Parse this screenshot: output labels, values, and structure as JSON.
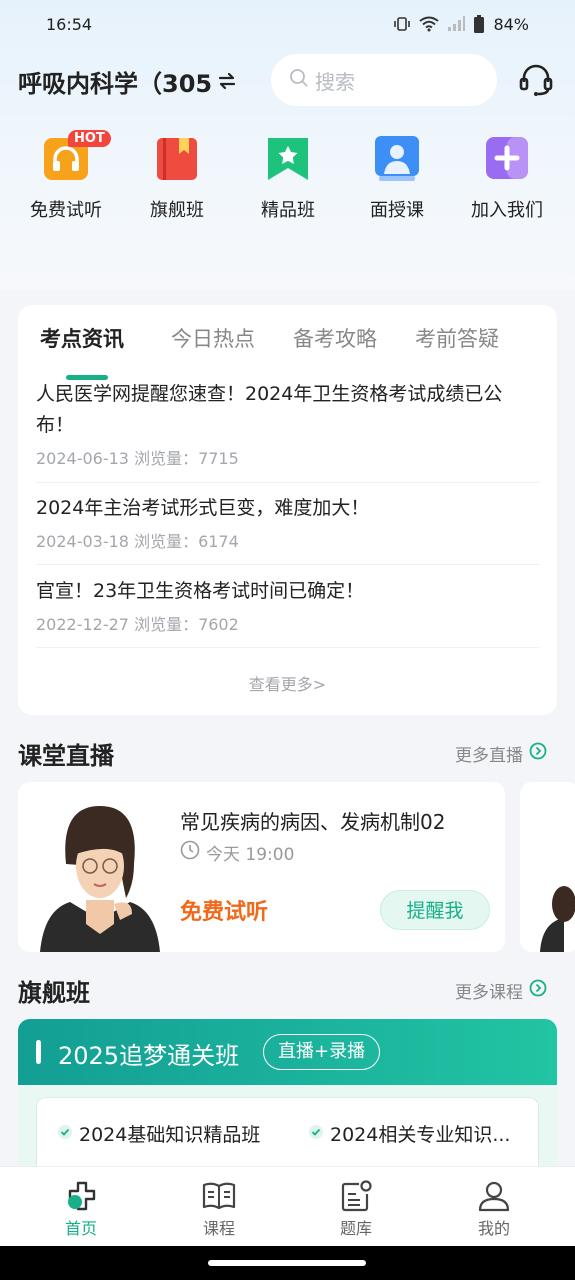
{
  "status_bar": {
    "time": "16:54",
    "battery": "84%"
  },
  "header": {
    "subject": "呼吸内科学（305",
    "search_placeholder": "搜索"
  },
  "quick_nav": [
    {
      "label": "免费试听",
      "badge": "HOT",
      "icon": "headphones-icon",
      "color": "#f7a21b"
    },
    {
      "label": "旗舰班",
      "icon": "book-bookmark-icon",
      "color": "#ef4b3e"
    },
    {
      "label": "精品班",
      "icon": "star-bookmark-icon",
      "color": "#1fc27c"
    },
    {
      "label": "面授课",
      "icon": "teacher-icon",
      "color": "#3d8ef5"
    },
    {
      "label": "加入我们",
      "icon": "join-plus-icon",
      "color": "#9a6cf2"
    }
  ],
  "news": {
    "tabs": [
      "考点资讯",
      "今日热点",
      "备考攻略",
      "考前答疑"
    ],
    "active_tab": 0,
    "items": [
      {
        "title": "人民医学网提醒您速查！2024年卫生资格考试成绩已公布！",
        "meta": "2024-06-13 浏览量：7715"
      },
      {
        "title": "2024年主治考试形式巨变，难度加大！",
        "meta": "2024-03-18 浏览量：6174"
      },
      {
        "title": "官宣！23年卫生资格考试时间已确定！",
        "meta": "2022-12-27 浏览量：7602"
      }
    ],
    "see_more": "查看更多>"
  },
  "live": {
    "section_title": "课堂直播",
    "more": "更多直播",
    "card": {
      "title": "常见疾病的病因、发病机制02",
      "time": "今天 19:00",
      "free": "免费试听",
      "remind": "提醒我"
    }
  },
  "flagship": {
    "section_title": "旗舰班",
    "more": "更多课程",
    "card": {
      "title": "2025追梦通关班",
      "tag": "直播+录播",
      "courses": [
        "2024基础知识精品班",
        "2024相关专业知识..."
      ]
    }
  },
  "bottom_nav": [
    {
      "label": "首页",
      "icon": "home-icon",
      "active": true
    },
    {
      "label": "课程",
      "icon": "course-book-icon",
      "active": false
    },
    {
      "label": "题库",
      "icon": "question-bank-icon",
      "active": false
    },
    {
      "label": "我的",
      "icon": "profile-icon",
      "active": false
    }
  ],
  "colors": {
    "accent": "#17b088",
    "free": "#f06a1a",
    "hot": "#f2463d"
  }
}
